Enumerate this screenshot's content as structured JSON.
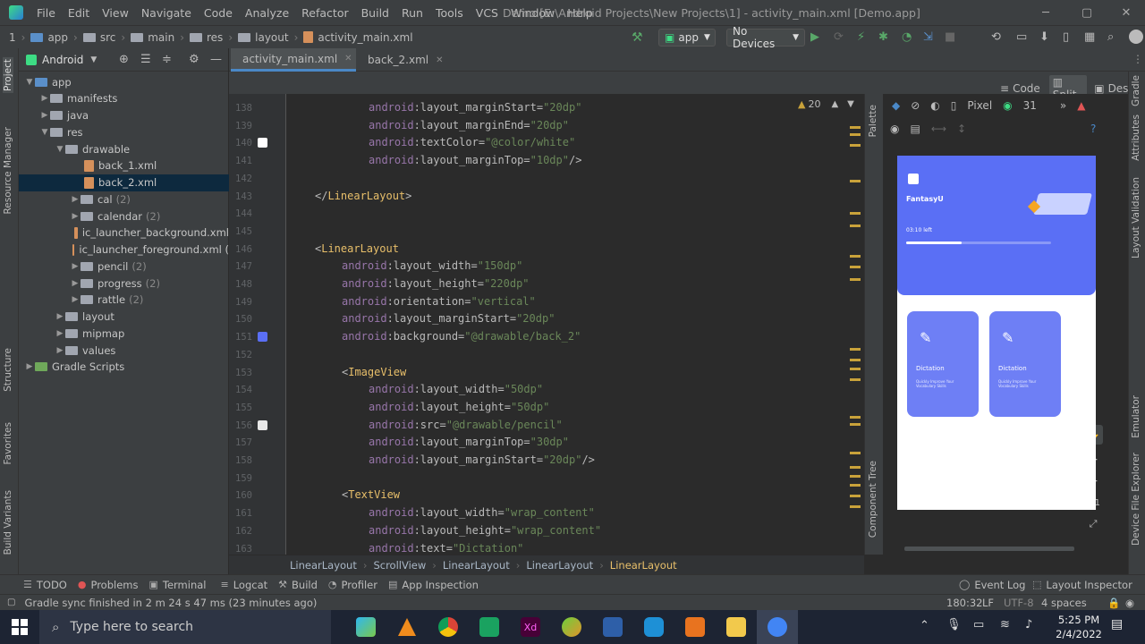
{
  "menubar": {
    "items": [
      "File",
      "Edit",
      "View",
      "Navigate",
      "Code",
      "Analyze",
      "Refactor",
      "Build",
      "Run",
      "Tools",
      "VCS",
      "Window",
      "Help"
    ],
    "title": "Demo [E:\\Android Projects\\New Projects\\1] - activity_main.xml [Demo.app]"
  },
  "navbar": {
    "crumbs": [
      "1",
      "app",
      "src",
      "main",
      "res",
      "layout",
      "activity_main.xml"
    ],
    "run_config": "app",
    "device": "No Devices"
  },
  "project": {
    "view": "Android",
    "tree": [
      {
        "label": "app",
        "depth": 0,
        "open": true,
        "type": "module"
      },
      {
        "label": "manifests",
        "depth": 1,
        "open": false,
        "type": "folder"
      },
      {
        "label": "java",
        "depth": 1,
        "open": false,
        "type": "folder"
      },
      {
        "label": "res",
        "depth": 1,
        "open": true,
        "type": "folder"
      },
      {
        "label": "drawable",
        "depth": 2,
        "open": true,
        "type": "folder"
      },
      {
        "label": "back_1.xml",
        "depth": 3,
        "type": "file"
      },
      {
        "label": "back_2.xml",
        "depth": 3,
        "type": "file",
        "selected": true
      },
      {
        "label": "cal",
        "count": "(2)",
        "depth": 3,
        "open": false,
        "type": "folder"
      },
      {
        "label": "calendar",
        "count": "(2)",
        "depth": 3,
        "open": false,
        "type": "folder"
      },
      {
        "label": "ic_launcher_background.xml",
        "depth": 3,
        "type": "file"
      },
      {
        "label": "ic_launcher_foreground.xml (",
        "depth": 3,
        "type": "file"
      },
      {
        "label": "pencil",
        "count": "(2)",
        "depth": 3,
        "open": false,
        "type": "folder"
      },
      {
        "label": "progress",
        "count": "(2)",
        "depth": 3,
        "open": false,
        "type": "folder"
      },
      {
        "label": "rattle",
        "count": "(2)",
        "depth": 3,
        "open": false,
        "type": "folder"
      },
      {
        "label": "layout",
        "depth": 2,
        "open": false,
        "type": "folder"
      },
      {
        "label": "mipmap",
        "depth": 2,
        "open": false,
        "type": "folder"
      },
      {
        "label": "values",
        "depth": 2,
        "open": false,
        "type": "folder"
      },
      {
        "label": "Gradle Scripts",
        "depth": 0,
        "open": false,
        "type": "gradle"
      }
    ]
  },
  "tabs": [
    {
      "label": "activity_main.xml",
      "active": true
    },
    {
      "label": "back_2.xml",
      "active": false
    }
  ],
  "view_modes": [
    "Code",
    "Split",
    "Design"
  ],
  "warnings": "20",
  "code_lines": [
    {
      "n": "138",
      "parts": [
        [
          "ns",
          "android"
        ],
        [
          "pun",
          ":layout_marginStart="
        ],
        [
          "val",
          "\"20dp\""
        ]
      ],
      "indent": 6
    },
    {
      "n": "139",
      "parts": [
        [
          "ns",
          "android"
        ],
        [
          "pun",
          ":layout_marginEnd="
        ],
        [
          "val",
          "\"20dp\""
        ]
      ],
      "indent": 6
    },
    {
      "n": "140",
      "parts": [
        [
          "ns",
          "android"
        ],
        [
          "pun",
          ":textColor="
        ],
        [
          "val",
          "\"@color/white\""
        ]
      ],
      "indent": 6
    },
    {
      "n": "141",
      "parts": [
        [
          "ns",
          "android"
        ],
        [
          "pun",
          ":layout_marginTop="
        ],
        [
          "val",
          "\"10dp\""
        ],
        [
          "pun",
          "/>"
        ]
      ],
      "indent": 6
    },
    {
      "n": "142",
      "parts": [],
      "indent": 0
    },
    {
      "n": "143",
      "parts": [
        [
          "pun",
          "</"
        ],
        [
          "tag",
          "LinearLayout"
        ],
        [
          "pun",
          ">"
        ]
      ],
      "indent": 2
    },
    {
      "n": "144",
      "parts": [],
      "indent": 0
    },
    {
      "n": "145",
      "parts": [],
      "indent": 0
    },
    {
      "n": "146",
      "parts": [
        [
          "pun",
          "<"
        ],
        [
          "tag",
          "LinearLayout"
        ]
      ],
      "indent": 2
    },
    {
      "n": "147",
      "parts": [
        [
          "ns",
          "android"
        ],
        [
          "pun",
          ":layout_width="
        ],
        [
          "val",
          "\"150dp\""
        ]
      ],
      "indent": 4
    },
    {
      "n": "148",
      "parts": [
        [
          "ns",
          "android"
        ],
        [
          "pun",
          ":layout_height="
        ],
        [
          "val",
          "\"220dp\""
        ]
      ],
      "indent": 4
    },
    {
      "n": "149",
      "parts": [
        [
          "ns",
          "android"
        ],
        [
          "pun",
          ":orientation="
        ],
        [
          "val",
          "\"vertical\""
        ]
      ],
      "indent": 4
    },
    {
      "n": "150",
      "parts": [
        [
          "ns",
          "android"
        ],
        [
          "pun",
          ":layout_marginStart="
        ],
        [
          "val",
          "\"20dp\""
        ]
      ],
      "indent": 4
    },
    {
      "n": "151",
      "parts": [
        [
          "ns",
          "android"
        ],
        [
          "pun",
          ":background="
        ],
        [
          "val",
          "\"@drawable/back_2\""
        ]
      ],
      "indent": 4
    },
    {
      "n": "152",
      "parts": [],
      "indent": 0
    },
    {
      "n": "153",
      "parts": [
        [
          "pun",
          "<"
        ],
        [
          "tag",
          "ImageView"
        ]
      ],
      "indent": 4
    },
    {
      "n": "154",
      "parts": [
        [
          "ns",
          "android"
        ],
        [
          "pun",
          ":layout_width="
        ],
        [
          "val",
          "\"50dp\""
        ]
      ],
      "indent": 6
    },
    {
      "n": "155",
      "parts": [
        [
          "ns",
          "android"
        ],
        [
          "pun",
          ":layout_height="
        ],
        [
          "val",
          "\"50dp\""
        ]
      ],
      "indent": 6
    },
    {
      "n": "156",
      "parts": [
        [
          "ns",
          "android"
        ],
        [
          "pun",
          ":src="
        ],
        [
          "val",
          "\"@drawable/pencil\""
        ]
      ],
      "indent": 6
    },
    {
      "n": "157",
      "parts": [
        [
          "ns",
          "android"
        ],
        [
          "pun",
          ":layout_marginTop="
        ],
        [
          "val",
          "\"30dp\""
        ]
      ],
      "indent": 6
    },
    {
      "n": "158",
      "parts": [
        [
          "ns",
          "android"
        ],
        [
          "pun",
          ":layout_marginStart="
        ],
        [
          "val",
          "\"20dp\""
        ],
        [
          "pun",
          "/>"
        ]
      ],
      "indent": 6
    },
    {
      "n": "159",
      "parts": [],
      "indent": 0
    },
    {
      "n": "160",
      "parts": [
        [
          "pun",
          "<"
        ],
        [
          "tag",
          "TextView"
        ]
      ],
      "indent": 4
    },
    {
      "n": "161",
      "parts": [
        [
          "ns",
          "android"
        ],
        [
          "pun",
          ":layout_width="
        ],
        [
          "val",
          "\"wrap_content\""
        ]
      ],
      "indent": 6
    },
    {
      "n": "162",
      "parts": [
        [
          "ns",
          "android"
        ],
        [
          "pun",
          ":layout_height="
        ],
        [
          "val",
          "\"wrap_content\""
        ]
      ],
      "indent": 6
    },
    {
      "n": "163",
      "parts": [
        [
          "ns",
          "android"
        ],
        [
          "pun",
          ":text="
        ],
        [
          "val",
          "\"Dictation\""
        ]
      ],
      "indent": 6
    }
  ],
  "editor_breadcrumb": [
    "LinearLayout",
    "ScrollView",
    "LinearLayout",
    "LinearLayout",
    "LinearLayout"
  ],
  "design": {
    "device": "Pixel",
    "api": "31",
    "app_name": "FantasyU",
    "progress_label": "03:10 left",
    "progress": 0.38,
    "cards": [
      {
        "title": "Dictation",
        "subtitle": "Quickly Improve Your Vocabulary Skills"
      },
      {
        "title": "Dictation",
        "subtitle": "Quickly Improve Your Vocabulary Skills"
      }
    ],
    "zoom_label": "1:1"
  },
  "left_strip": [
    "Project",
    "Resource Manager",
    "Structure",
    "Favorites",
    "Build Variants"
  ],
  "right_strip": [
    "Gradle",
    "Attributes",
    "Layout Validation",
    "Emulator",
    "Device File Explorer"
  ],
  "design_side": [
    "Palette",
    "Component Tree"
  ],
  "bottom_tools": [
    "TODO",
    "Problems",
    "Terminal",
    "Logcat",
    "Build",
    "Profiler",
    "App Inspection"
  ],
  "bottom_right": [
    "Event Log",
    "Layout Inspector"
  ],
  "status": {
    "message": "Gradle sync finished in 2 m 24 s 47 ms (23 minutes ago)",
    "position": "180:32",
    "line_sep": "LF",
    "encoding": "UTF-8",
    "indent": "4 spaces"
  },
  "taskbar": {
    "search_placeholder": "Type here to search",
    "time": "5:25 PM",
    "date": "2/4/2022"
  }
}
